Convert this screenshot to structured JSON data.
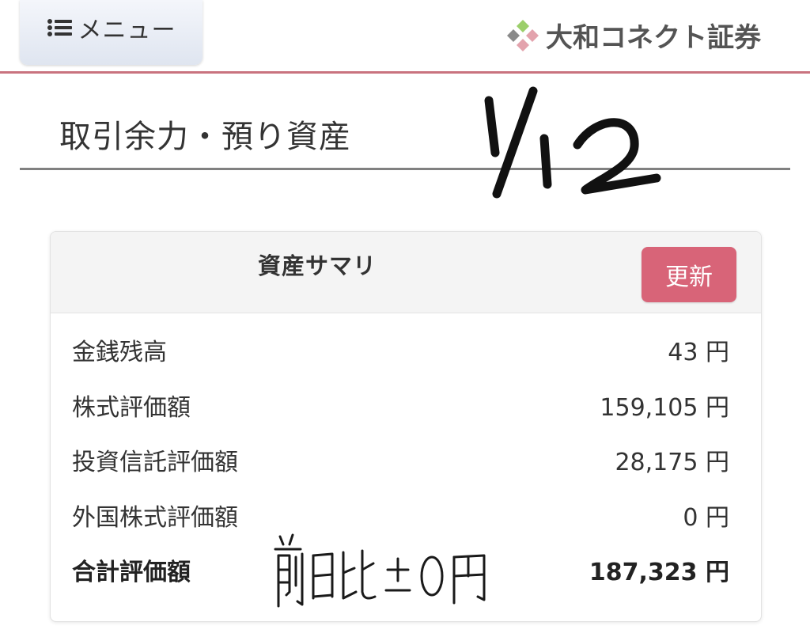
{
  "header": {
    "menu_label": "メニュー",
    "brand_name": "大和コネクト証券",
    "accent_color": "#c9737f"
  },
  "page": {
    "title": "取引余力・預り資産"
  },
  "annotations": {
    "date_handwritten": "1/12",
    "note_handwritten": "前日比 ±0円"
  },
  "summary": {
    "title": "資産サマリ",
    "refresh_label": "更新",
    "refresh_color": "#d86478",
    "rows": [
      {
        "label": "金銭残高",
        "value": "43",
        "unit": "円"
      },
      {
        "label": "株式評価額",
        "value": "159,105",
        "unit": "円"
      },
      {
        "label": "投資信託評価額",
        "value": "28,175",
        "unit": "円"
      },
      {
        "label": "外国株式評価額",
        "value": "0",
        "unit": "円"
      }
    ],
    "total": {
      "label": "合計評価額",
      "value": "187,323",
      "unit": "円"
    }
  }
}
